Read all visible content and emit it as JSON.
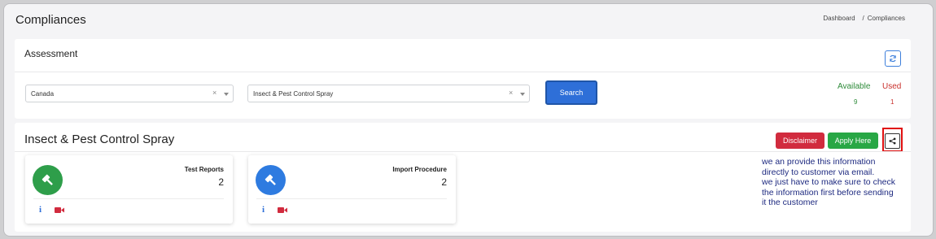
{
  "page": {
    "title": "Compliances"
  },
  "breadcrumb": {
    "home": "Dashboard",
    "separator": "/",
    "current": "Compliances"
  },
  "assessment": {
    "header": "Assessment",
    "refresh_icon": "refresh-icon",
    "country_select": {
      "value": "Canada",
      "clear": "×"
    },
    "product_select": {
      "value": "Insect & Pest Control Spray",
      "clear": "×"
    },
    "search_label": "Search",
    "available_label": "Available",
    "available_value": "9",
    "used_label": "Used",
    "used_value": "1"
  },
  "result": {
    "title": "Insect & Pest Control Spray",
    "disclaimer_label": "Disclaimer",
    "apply_label": "Apply Here",
    "share_icon": "share-icon",
    "tiles": [
      {
        "label": "Test Reports",
        "count": "2",
        "icon": "gavel-icon",
        "color": "#2e9e4a",
        "info": "i"
      },
      {
        "label": "Import Procedure",
        "count": "2",
        "icon": "gavel-icon",
        "color": "#2e7be0",
        "info": "i"
      }
    ]
  },
  "annotation": {
    "lines": [
      "we an provide this information",
      "directly to customer via email.",
      "we just have to make sure to check",
      "the information first before sending",
      "it the customer"
    ]
  },
  "colors": {
    "primary": "#2e6fd8",
    "success": "#28a745",
    "danger": "#d12b3e",
    "highlight": "#e01010"
  }
}
